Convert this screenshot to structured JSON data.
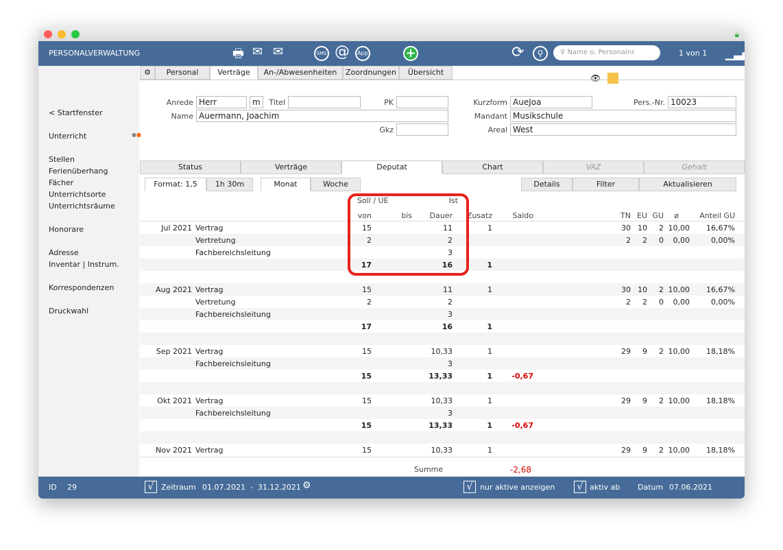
{
  "header": {
    "title": "PERSONALVERWALTUNG",
    "search_placeholder": "Name o. Personalnr.",
    "record_pos": "1 von 1"
  },
  "tabs": [
    "Personal",
    "Verträge",
    "An-/Abwesenheiten",
    "Zoordnungen",
    "Übersicht"
  ],
  "sidebar": [
    "< Startfenster",
    "Unterricht",
    "Stellen",
    "Ferienüberhang",
    "Fächer",
    "Unterrichtsorte",
    "Unterrichtsräume",
    "Honorare",
    "Adresse",
    "Inventar | Instrum.",
    "Korrespondenzen",
    "Druckwahl"
  ],
  "form": {
    "anrede_label": "Anrede",
    "anrede": "Herr",
    "geschlecht": "m",
    "titel_label": "Titel",
    "titel": "",
    "pk_label": "PK",
    "pk": "",
    "name_label": "Name",
    "name": "Auermann, Joachim",
    "gkz_label": "Gkz",
    "gkz": "",
    "kurzform_label": "Kurzform",
    "kurzform": "AueJoa",
    "persnr_label": "Pers.-Nr.",
    "persnr": "10023",
    "mandant_label": "Mandant",
    "mandant": "Musikschule",
    "areal_label": "Areal",
    "areal": "West"
  },
  "subtabs": [
    "Status",
    "Verträge",
    "Deputat",
    "Chart",
    "VAZ",
    "Gehalt"
  ],
  "toolbar": {
    "format": "Format: 1,5",
    "time": "1h 30m",
    "monat": "Monat",
    "woche": "Woche",
    "details": "Details",
    "filter": "Filter",
    "aktualisieren": "Aktualisieren"
  },
  "columns": {
    "soll": "Soll / UE",
    "ist": "Ist",
    "von": "von",
    "bis": "bis",
    "dauer": "Dauer",
    "zusatz": "Zusatz",
    "saldo": "Saldo",
    "tn": "TN",
    "eu": "EU",
    "gu": "GU",
    "avg": "ø",
    "anteil": "Anteil GU"
  },
  "rows": [
    [
      "Jul 2021",
      "Vertrag",
      "15",
      "",
      "11",
      "1",
      "",
      "30",
      "10",
      "2",
      "10,00",
      "16,67%"
    ],
    [
      "",
      "Vertretung",
      "2",
      "",
      "2",
      "",
      "",
      "2",
      "2",
      "0",
      "0,00",
      "0,00%"
    ],
    [
      "",
      "Fachbereichsleitung",
      "",
      "",
      "3",
      "",
      "",
      "",
      "",
      "",
      "",
      ""
    ],
    [
      "",
      "",
      "17",
      "",
      "16",
      "1",
      "",
      "",
      "",
      "",
      "",
      "",
      "b"
    ],
    [
      "",
      "",
      "",
      "",
      "",
      "",
      "",
      "",
      "",
      "",
      "",
      ""
    ],
    [
      "Aug 2021",
      "Vertrag",
      "15",
      "",
      "11",
      "1",
      "",
      "30",
      "10",
      "2",
      "10,00",
      "16,67%"
    ],
    [
      "",
      "Vertretung",
      "2",
      "",
      "2",
      "",
      "",
      "2",
      "2",
      "0",
      "0,00",
      "0,00%"
    ],
    [
      "",
      "Fachbereichsleitung",
      "",
      "",
      "3",
      "",
      "",
      "",
      "",
      "",
      "",
      ""
    ],
    [
      "",
      "",
      "17",
      "",
      "16",
      "1",
      "",
      "",
      "",
      "",
      "",
      "",
      "b"
    ],
    [
      "",
      "",
      "",
      "",
      "",
      "",
      "",
      "",
      "",
      "",
      "",
      ""
    ],
    [
      "Sep 2021",
      "Vertrag",
      "15",
      "",
      "10,33",
      "1",
      "",
      "29",
      "9",
      "2",
      "10,00",
      "18,18%"
    ],
    [
      "",
      "Fachbereichsleitung",
      "",
      "",
      "3",
      "",
      "",
      "",
      "",
      "",
      "",
      ""
    ],
    [
      "",
      "",
      "15",
      "",
      "13,33",
      "1",
      "-0,67",
      "",
      "",
      "",
      "",
      "",
      "b"
    ],
    [
      "",
      "",
      "",
      "",
      "",
      "",
      "",
      "",
      "",
      "",
      "",
      ""
    ],
    [
      "Okt 2021",
      "Vertrag",
      "15",
      "",
      "10,33",
      "1",
      "",
      "29",
      "9",
      "2",
      "10,00",
      "18,18%"
    ],
    [
      "",
      "Fachbereichsleitung",
      "",
      "",
      "3",
      "",
      "",
      "",
      "",
      "",
      "",
      ""
    ],
    [
      "",
      "",
      "15",
      "",
      "13,33",
      "1",
      "-0,67",
      "",
      "",
      "",
      "",
      "",
      "b"
    ],
    [
      "",
      "",
      "",
      "",
      "",
      "",
      "",
      "",
      "",
      "",
      "",
      ""
    ],
    [
      "Nov 2021",
      "Vertrag",
      "15",
      "",
      "10,33",
      "1",
      "",
      "29",
      "9",
      "2",
      "10,00",
      "18,18%"
    ]
  ],
  "summe": {
    "label": "Summe",
    "value": "-2,68"
  },
  "footer": {
    "id_label": "ID",
    "id": "29",
    "zeitraum": "Zeitraum",
    "range": "01.07.2021  -  31.12.2021",
    "nur_aktive": "nur aktive anzeigen",
    "aktiv_ab": "aktiv ab",
    "datum_label": "Datum",
    "datum": "07.06.2021",
    "check": "√"
  },
  "colors": {
    "header": "#466b98",
    "highlight": "#e8221b",
    "negative": "#d40000"
  }
}
